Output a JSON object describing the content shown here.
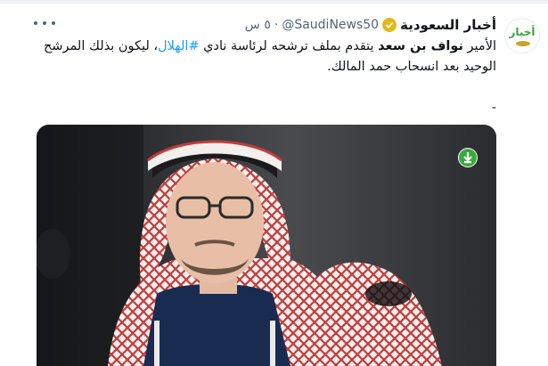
{
  "account": {
    "name": "أخبار السعودية",
    "handle": "@SaudiNews50",
    "separator": "·",
    "time": "٥ س",
    "avatar_text": "أخبار"
  },
  "tweet": {
    "text_part1": "الأمير ",
    "text_bold": "نواف بن سعد",
    "text_part2": " يتقدم بملف ترشحه لرئاسة نادي ",
    "hashtag": "#الهلال",
    "text_part3": "، ليكون بذلك المرشح الوحيد بعد انسحاب حمد المالك.",
    "trailing": "-"
  },
  "icons": {
    "more": "more-horizontal-icon",
    "verified": "verified-badge-icon",
    "download": "download-arrow-icon"
  },
  "colors": {
    "hashtag": "#1d9bf0",
    "verified_badge": "#e2b719",
    "secondary_text": "#536471",
    "download_button": "#3ca93f"
  }
}
